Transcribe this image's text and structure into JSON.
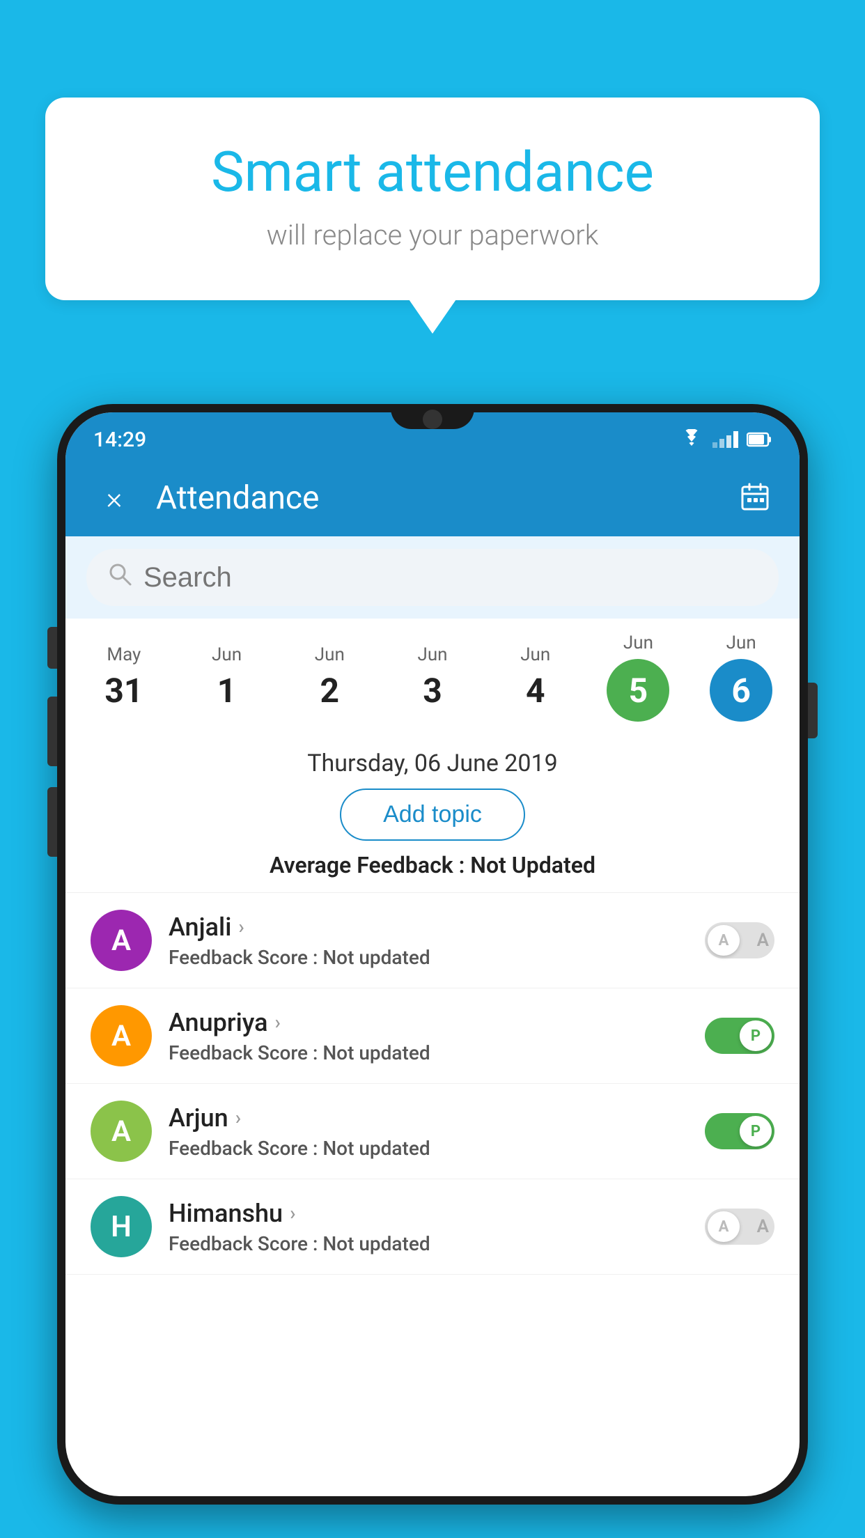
{
  "background_color": "#1ab8e8",
  "bubble": {
    "title": "Smart attendance",
    "subtitle": "will replace your paperwork"
  },
  "status_bar": {
    "time": "14:29"
  },
  "app_bar": {
    "title": "Attendance",
    "close_label": "×"
  },
  "search": {
    "placeholder": "Search"
  },
  "dates": [
    {
      "month": "May",
      "day": "31",
      "active": false
    },
    {
      "month": "Jun",
      "day": "1",
      "active": false
    },
    {
      "month": "Jun",
      "day": "2",
      "active": false
    },
    {
      "month": "Jun",
      "day": "3",
      "active": false
    },
    {
      "month": "Jun",
      "day": "4",
      "active": false
    },
    {
      "month": "Jun",
      "day": "5",
      "active": "green"
    },
    {
      "month": "Jun",
      "day": "6",
      "active": "blue"
    }
  ],
  "selected_date": "Thursday, 06 June 2019",
  "add_topic_label": "Add topic",
  "avg_feedback_label": "Average Feedback :",
  "avg_feedback_value": "Not Updated",
  "students": [
    {
      "name": "Anjali",
      "avatar_letter": "A",
      "avatar_color": "purple",
      "feedback_label": "Feedback Score :",
      "feedback_value": "Not updated",
      "attendance": "A",
      "present": false
    },
    {
      "name": "Anupriya",
      "avatar_letter": "A",
      "avatar_color": "orange",
      "feedback_label": "Feedback Score :",
      "feedback_value": "Not updated",
      "attendance": "P",
      "present": true
    },
    {
      "name": "Arjun",
      "avatar_letter": "A",
      "avatar_color": "lightgreen",
      "feedback_label": "Feedback Score :",
      "feedback_value": "Not updated",
      "attendance": "P",
      "present": true
    },
    {
      "name": "Himanshu",
      "avatar_letter": "H",
      "avatar_color": "teal",
      "feedback_label": "Feedback Score :",
      "feedback_value": "Not updated",
      "attendance": "A",
      "present": false
    }
  ]
}
